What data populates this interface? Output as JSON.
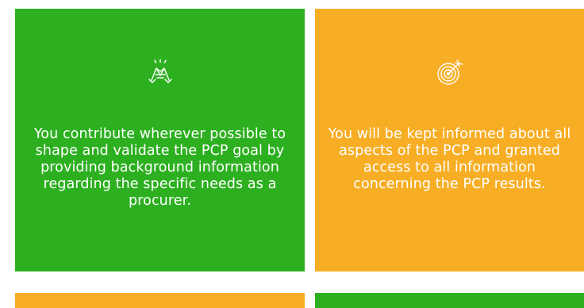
{
  "colors": {
    "green": "#2db020",
    "orange": "#f7ae24"
  },
  "cards": [
    {
      "icon": "handshake-icon",
      "color": "#2db020",
      "text": "You contribute wherever possible to shape and validate the PCP goal by providing background information regarding the specific needs as a procurer."
    },
    {
      "icon": "target-icon",
      "color": "#f7ae24",
      "text": "You will be kept informed about all aspects of the PCP and granted access to all information concerning the PCP results."
    },
    {
      "color": "#f7ae24"
    },
    {
      "color": "#2db020"
    }
  ]
}
